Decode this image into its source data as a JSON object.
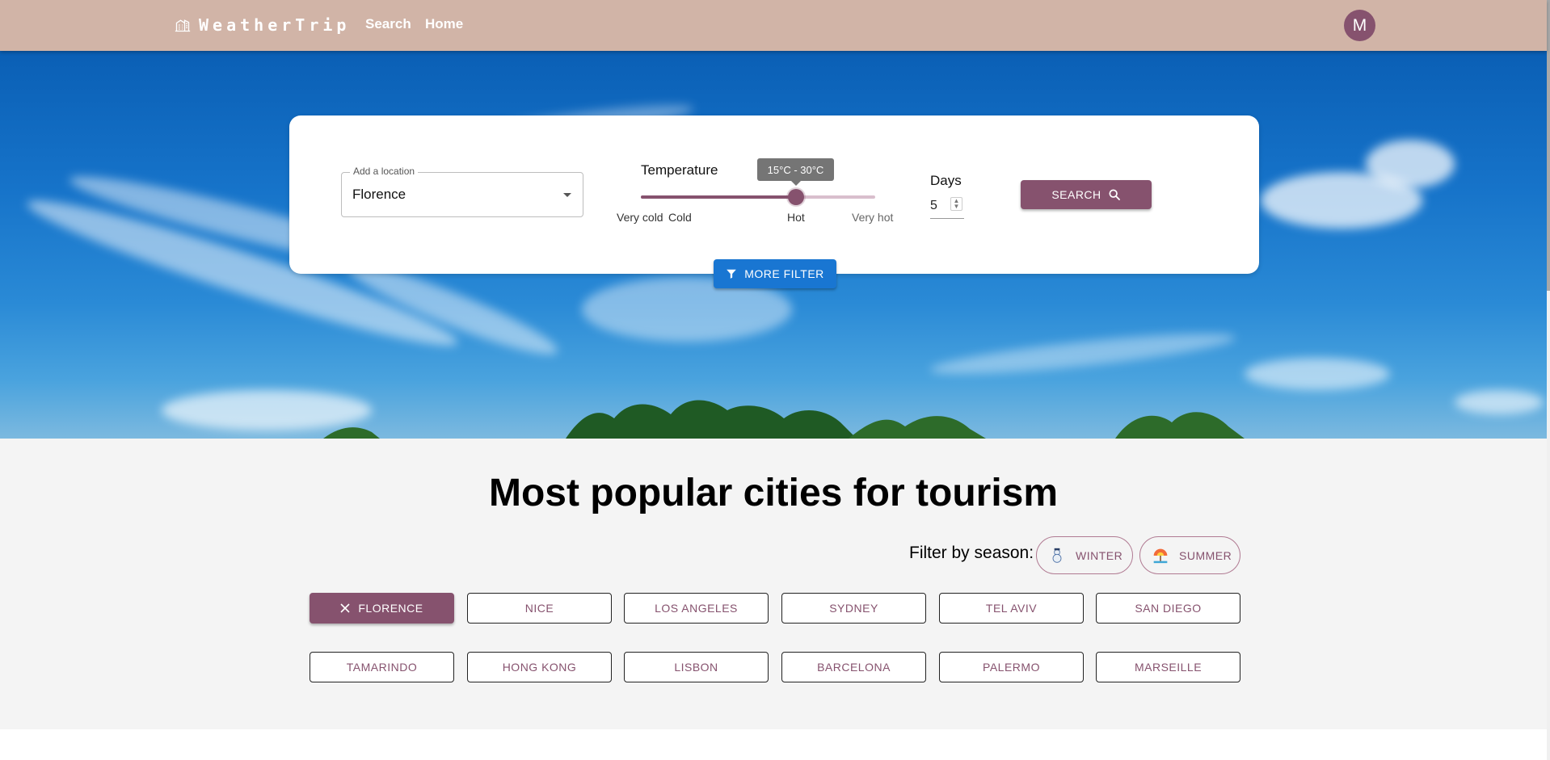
{
  "header": {
    "logo_icon": "building-icon",
    "logo_text": "WeatherTrip",
    "nav": [
      "Search",
      "Home"
    ],
    "avatar_initial": "M",
    "bar_color": "#d1b4a7",
    "accent_color": "#86526e"
  },
  "search": {
    "location_label": "Add a location",
    "location_value": "Florence",
    "temperature_label": "Temperature",
    "temperature_tooltip": "15°C - 30°C",
    "temperature_marks": [
      "Very cold",
      "Cold",
      "Hot",
      "Very hot"
    ],
    "temperature_level": 0.67,
    "days_label": "Days",
    "days_value": "5",
    "search_button": "SEARCH",
    "more_filter_button": "MORE FILTER"
  },
  "popular": {
    "title": "Most popular cities for tourism",
    "filter_label": "Filter by season:",
    "seasons": [
      {
        "label": "WINTER",
        "icon": "snowman-icon"
      },
      {
        "label": "SUMMER",
        "icon": "beach-icon"
      }
    ],
    "cities": [
      "FLORENCE",
      "NICE",
      "LOS ANGELES",
      "SYDNEY",
      "TEL AVIV",
      "SAN DIEGO",
      "TAMARINDO",
      "HONG KONG",
      "LISBON",
      "BARCELONA",
      "PALERMO",
      "MARSEILLE"
    ],
    "selected_city": "FLORENCE"
  }
}
